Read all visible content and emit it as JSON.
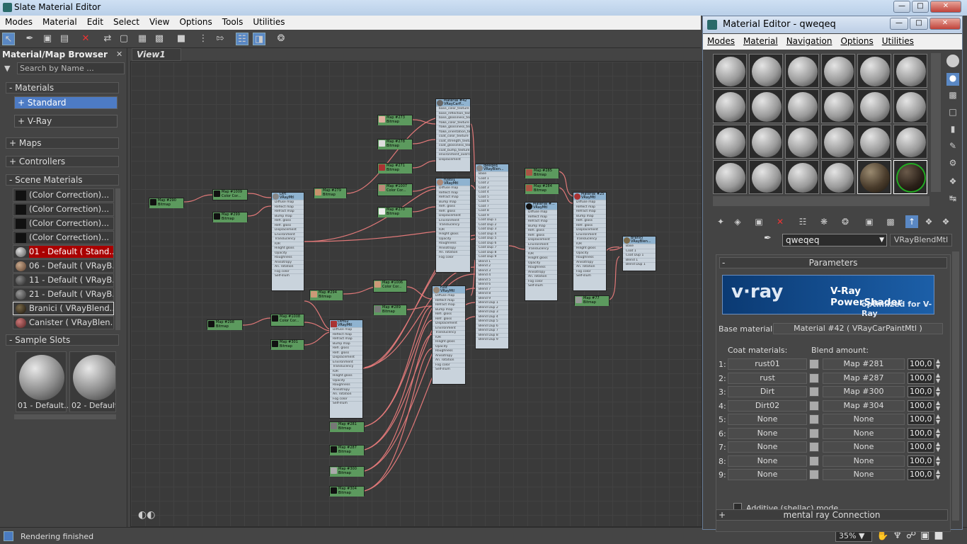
{
  "app": {
    "title": "Slate Material Editor"
  },
  "menu": [
    "Modes",
    "Material",
    "Edit",
    "Select",
    "View",
    "Options",
    "Tools",
    "Utilities"
  ],
  "browser": {
    "title": "Material/Map Browser",
    "search_placeholder": "Search by Name ...",
    "groups": {
      "materials": "- Materials",
      "standard": "+ Standard",
      "vray": "+ V-Ray",
      "maps": "+ Maps",
      "controllers": "+ Controllers",
      "scene": "- Scene Materials",
      "samples": "- Sample Slots"
    },
    "scene_items": [
      "(Color Correction)...",
      "(Color Correction)...",
      "(Color Correction)...",
      "(Color Correction)...",
      "01 - Default  ( Stand...",
      "06 - Default  ( VRayB...",
      "11 - Default  ( VRayB...",
      "21 - Default  ( VRayB...",
      "Branici  ( VRayBlend...",
      "Canister  ( VRayBlen..."
    ],
    "slots": [
      "01 - Default...",
      "02 - Default"
    ]
  },
  "view": {
    "tab": "View1"
  },
  "status": {
    "text": "Rendering finished",
    "zoom": "35%"
  },
  "medit": {
    "title": "Material Editor - qweqeq",
    "menu": [
      "Modes",
      "Material",
      "Navigation",
      "Options",
      "Utilities"
    ],
    "name": "qweqeq",
    "type": "VRayBlendMtl",
    "params_label": "Parameters",
    "banner_title": "V-Ray PowerShader",
    "banner_sub": "optimized for V-Ray",
    "logo": "v·ray",
    "base_label": "Base material:",
    "base_value": "Material #42  ( VRayCarPaintMtl )",
    "coat_label": "Coat materials:",
    "blend_label": "Blend amount:",
    "rows": [
      {
        "n": "1:",
        "coat": "rust01",
        "blend": "Map #281",
        "amt": "100,0"
      },
      {
        "n": "2:",
        "coat": "rust",
        "blend": "Map #287",
        "amt": "100,0"
      },
      {
        "n": "3:",
        "coat": "Dirt",
        "blend": "Map #300",
        "amt": "100,0"
      },
      {
        "n": "4:",
        "coat": "Dirt02",
        "blend": "Map #304",
        "amt": "100,0"
      },
      {
        "n": "5:",
        "coat": "None",
        "blend": "None",
        "amt": "100,0"
      },
      {
        "n": "6:",
        "coat": "None",
        "blend": "None",
        "amt": "100,0"
      },
      {
        "n": "7:",
        "coat": "None",
        "blend": "None",
        "amt": "100,0"
      },
      {
        "n": "8:",
        "coat": "None",
        "blend": "None",
        "amt": "100,0"
      },
      {
        "n": "9:",
        "coat": "None",
        "blend": "None",
        "amt": "100,0"
      }
    ],
    "additive": "Additive (shellac) mode",
    "mentalray": "mental ray Connection"
  }
}
